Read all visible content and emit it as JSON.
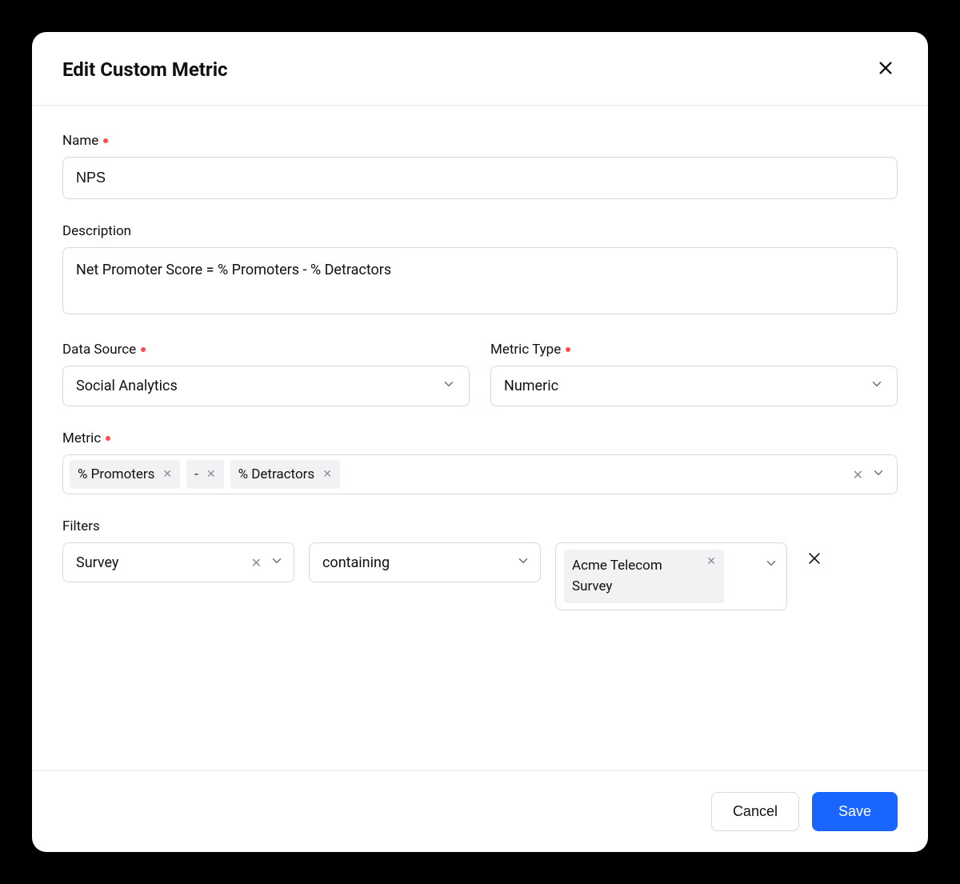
{
  "modal": {
    "title": "Edit Custom Metric"
  },
  "fields": {
    "name": {
      "label": "Name",
      "required": true,
      "value": "NPS"
    },
    "description": {
      "label": "Description",
      "required": false,
      "value": "Net Promoter Score = % Promoters - % Detractors"
    },
    "dataSource": {
      "label": "Data Source",
      "required": true,
      "value": "Social Analytics"
    },
    "metricType": {
      "label": "Metric Type",
      "required": true,
      "value": "Numeric"
    },
    "metric": {
      "label": "Metric",
      "required": true,
      "chips": [
        "% Promoters",
        "-",
        "% Detractors"
      ]
    },
    "filters": {
      "label": "Filters",
      "row": {
        "field": "Survey",
        "condition": "containing",
        "value": "Acme Telecom Survey"
      }
    }
  },
  "footer": {
    "cancel": "Cancel",
    "save": "Save"
  }
}
